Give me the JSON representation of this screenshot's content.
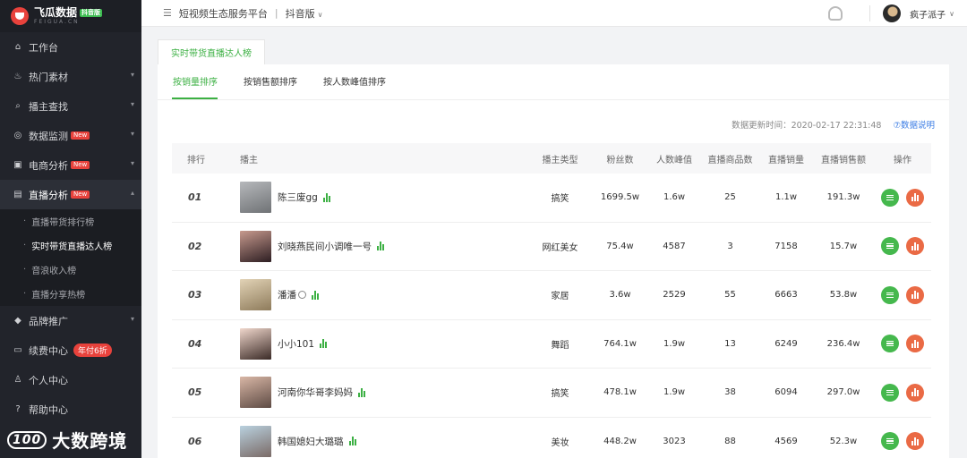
{
  "app": {
    "logo_title": "飞瓜数据",
    "logo_badge": "抖音版",
    "logo_sub": "FEIGUA.CN"
  },
  "header": {
    "platform": "短视频生态服务平台",
    "separator": "|",
    "version": "抖音版",
    "user_name": "疯子派子"
  },
  "sidebar": {
    "items": [
      {
        "label": "工作台",
        "icon": "home-icon"
      },
      {
        "label": "热门素材",
        "icon": "fire-icon"
      },
      {
        "label": "播主查找",
        "icon": "search-icon"
      },
      {
        "label": "数据监测",
        "icon": "monitor-icon",
        "badge": "New"
      },
      {
        "label": "电商分析",
        "icon": "cart-icon",
        "badge": "New"
      },
      {
        "label": "直播分析",
        "icon": "live-icon",
        "badge": "New"
      }
    ],
    "live_submenu": [
      {
        "label": "直播带货排行榜"
      },
      {
        "label": "实时带货直播达人榜"
      },
      {
        "label": "音浪收入榜"
      },
      {
        "label": "直播分享热榜"
      }
    ],
    "items_after": [
      {
        "label": "品牌推广",
        "icon": "diamond-icon"
      },
      {
        "label": "续费中心",
        "icon": "card-icon",
        "badge": "年付6折"
      },
      {
        "label": "个人中心",
        "icon": "user-icon"
      },
      {
        "label": "帮助中心",
        "icon": "help-icon"
      }
    ],
    "watermark": "大数跨境",
    "watermark_mark": "100"
  },
  "page": {
    "tab_title": "实时带货直播达人榜",
    "subtabs": [
      "按销量排序",
      "按销售额排序",
      "按人数峰值排序"
    ],
    "update_time": "数据更新时间：2020-02-17 22:31:48",
    "help_link": "⑦数据说明"
  },
  "table": {
    "headers": [
      "排行",
      "播主",
      "播主类型",
      "粉丝数",
      "人数峰值",
      "直播商品数",
      "直播销量",
      "直播销售额",
      "操作"
    ],
    "rows": [
      {
        "rank": "01",
        "name": "陈三废gg",
        "type": "搞笑",
        "fans": "1699.5w",
        "peak": "1.6w",
        "goods": "25",
        "sales": "1.1w",
        "amount": "191.3w",
        "avatar": [
          "#6f7275",
          "#b6b8bb"
        ]
      },
      {
        "rank": "02",
        "name": "刘晓燕民间小调唯一号",
        "type": "网红美女",
        "fans": "75.4w",
        "peak": "4587",
        "goods": "3",
        "sales": "7158",
        "amount": "15.7w",
        "avatar": [
          "#2d1e22",
          "#c79a8e"
        ]
      },
      {
        "rank": "03",
        "name": "潘潘",
        "type": "家居",
        "fans": "3.6w",
        "peak": "2529",
        "goods": "55",
        "sales": "6663",
        "amount": "53.8w",
        "avatar": [
          "#8e7b5b",
          "#e2d3b6"
        ]
      },
      {
        "rank": "04",
        "name": "小小101",
        "type": "舞蹈",
        "fans": "764.1w",
        "peak": "1.9w",
        "goods": "13",
        "sales": "6249",
        "amount": "236.4w",
        "avatar": [
          "#3a2a26",
          "#f0d7cc"
        ]
      },
      {
        "rank": "05",
        "name": "河南你华哥李妈妈",
        "type": "搞笑",
        "fans": "478.1w",
        "peak": "1.9w",
        "goods": "38",
        "sales": "6094",
        "amount": "297.0w",
        "avatar": [
          "#5d4a43",
          "#d9b7a6"
        ]
      },
      {
        "rank": "06",
        "name": "韩国媳妇大璐璐",
        "type": "美妆",
        "fans": "448.2w",
        "peak": "3023",
        "goods": "88",
        "sales": "4569",
        "amount": "52.3w",
        "avatar": [
          "#7a6a66",
          "#b9d1df"
        ]
      }
    ]
  },
  "colors": {
    "accent_green": "#3cb043",
    "badge_red": "#e8423c",
    "op_orange": "#ea6a45",
    "link_blue": "#3d7ee5",
    "sidebar_bg": "#22242b"
  }
}
